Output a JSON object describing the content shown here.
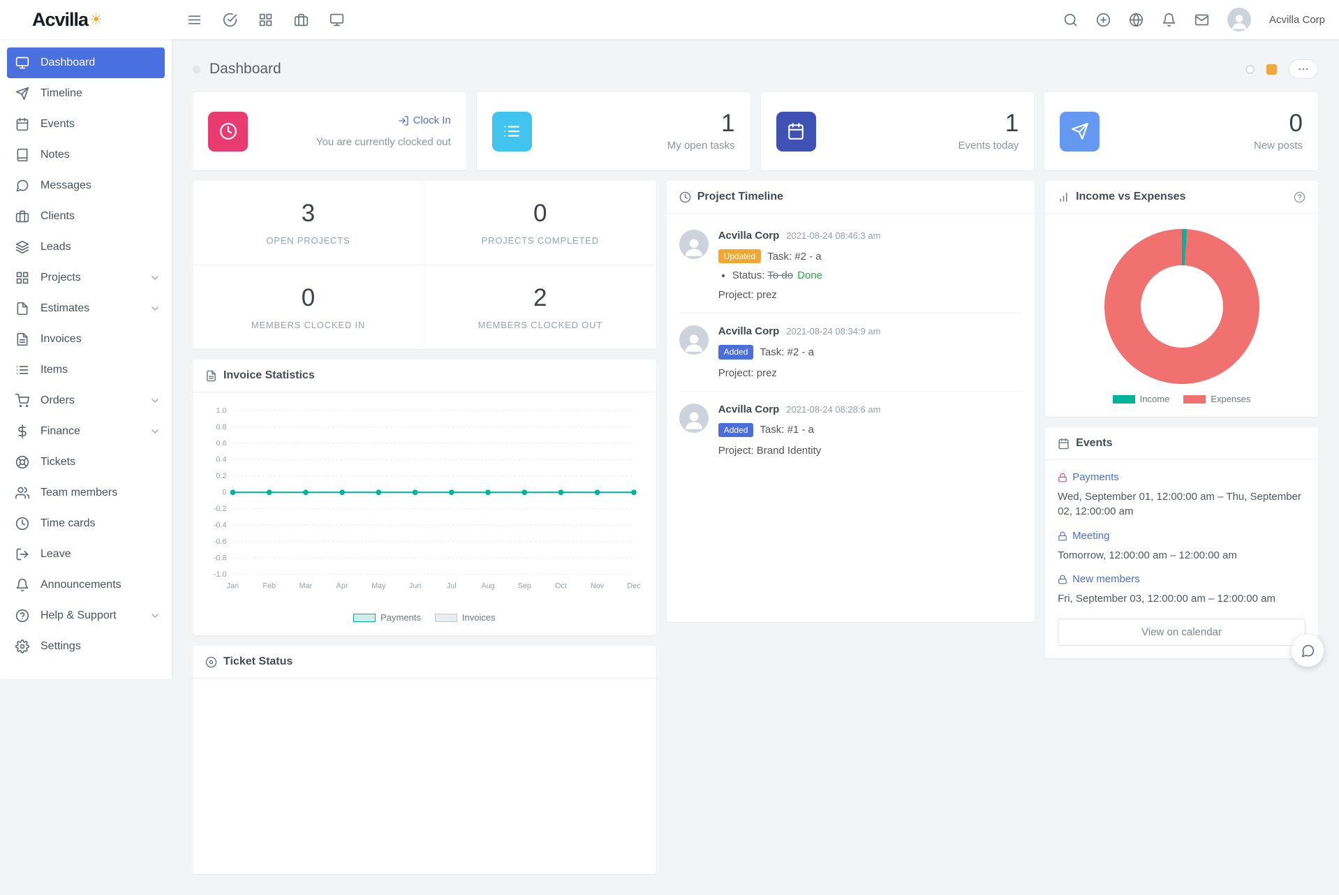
{
  "app": {
    "logo_text": "Acvilla",
    "workspace_name": "Acvilla Corp"
  },
  "page": {
    "title": "Dashboard"
  },
  "colors": {
    "accent": "#4a6fe0",
    "link": "#4a6fdd",
    "success": "#28a745"
  },
  "sidebar": {
    "items": [
      {
        "label": "Dashboard",
        "icon": "monitor",
        "active": true
      },
      {
        "label": "Timeline",
        "icon": "send"
      },
      {
        "label": "Events",
        "icon": "calendar"
      },
      {
        "label": "Notes",
        "icon": "book"
      },
      {
        "label": "Messages",
        "icon": "message-circle"
      },
      {
        "label": "Clients",
        "icon": "briefcase"
      },
      {
        "label": "Leads",
        "icon": "layers"
      },
      {
        "label": "Projects",
        "icon": "grid",
        "expandable": true
      },
      {
        "label": "Estimates",
        "icon": "file",
        "expandable": true
      },
      {
        "label": "Invoices",
        "icon": "file-text"
      },
      {
        "label": "Items",
        "icon": "list"
      },
      {
        "label": "Orders",
        "icon": "shopping-cart",
        "expandable": true
      },
      {
        "label": "Finance",
        "icon": "dollar-sign",
        "expandable": true
      },
      {
        "label": "Tickets",
        "icon": "life-buoy"
      },
      {
        "label": "Team members",
        "icon": "users"
      },
      {
        "label": "Time cards",
        "icon": "clock"
      },
      {
        "label": "Leave",
        "icon": "log-out"
      },
      {
        "label": "Announcements",
        "icon": "bell"
      },
      {
        "label": "Help & Support",
        "icon": "help-circle",
        "expandable": true
      },
      {
        "label": "Settings",
        "icon": "settings"
      }
    ]
  },
  "summary_cards": [
    {
      "icon": "clock",
      "tile_color": "#e93a71",
      "action_label": "Clock In",
      "subtitle": "You are currently clocked out"
    },
    {
      "icon": "list",
      "tile_color": "#41c5ee",
      "value": "1",
      "label": "My open tasks"
    },
    {
      "icon": "calendar",
      "tile_color": "#3f51b5",
      "value": "1",
      "label": "Events today"
    },
    {
      "icon": "send",
      "tile_color": "#6598f1",
      "value": "0",
      "label": "New posts"
    }
  ],
  "stats": [
    {
      "value": "3",
      "label": "OPEN PROJECTS"
    },
    {
      "value": "0",
      "label": "PROJECTS COMPLETED"
    },
    {
      "value": "0",
      "label": "MEMBERS CLOCKED IN"
    },
    {
      "value": "2",
      "label": "MEMBERS CLOCKED OUT"
    }
  ],
  "project_timeline": {
    "title": "Project Timeline",
    "entries": [
      {
        "author": "Acvilla Corp",
        "timestamp": "2021-08-24 08:46:3 am",
        "badge": "Updated",
        "badge_color": "#f3a72e",
        "task": "Task: #2 - a",
        "status_prefix": "Status:",
        "status_old": "To do",
        "status_new": "Done",
        "project": "Project: prez"
      },
      {
        "author": "Acvilla Corp",
        "timestamp": "2021-08-24 08:34:9 am",
        "badge": "Added",
        "badge_color": "#4a6fdd",
        "task": "Task: #2 - a",
        "project": "Project: prez"
      },
      {
        "author": "Acvilla Corp",
        "timestamp": "2021-08-24 08:28:6 am",
        "badge": "Added",
        "badge_color": "#4a6fdd",
        "task": "Task: #1 - a",
        "project": "Project: Brand Identity"
      }
    ]
  },
  "income_vs_expenses": {
    "title": "Income vs Expenses"
  },
  "invoice_statistics": {
    "title": "Invoice Statistics"
  },
  "ticket_status": {
    "title": "Ticket Status"
  },
  "events": {
    "title": "Events",
    "items": [
      {
        "title": "Payments",
        "icon_color": "#e83e8c",
        "time": "Wed, September 01, 12:00:00 am – Thu, September 02, 12:00:00 am"
      },
      {
        "title": "Meeting",
        "icon_color": "#4a6fdd",
        "time": "Tomorrow, 12:00:00 am – 12:00:00 am"
      },
      {
        "title": "New members",
        "icon_color": "#4a6fdd",
        "time": "Fri, September 03, 12:00:00 am – 12:00:00 am"
      }
    ],
    "button_label": "View on calendar"
  },
  "chart_data": [
    {
      "type": "line",
      "title": "Invoice Statistics",
      "categories": [
        "Jan",
        "Feb",
        "Mar",
        "Apr",
        "May",
        "Jun",
        "Jul",
        "Aug",
        "Sep",
        "Oct",
        "Nov",
        "Dec"
      ],
      "series": [
        {
          "name": "Payments",
          "values": [
            0,
            0,
            0,
            0,
            0,
            0,
            0,
            0,
            0,
            0,
            0,
            0
          ],
          "color": "#00b39b",
          "swatch": "#cdeee8"
        },
        {
          "name": "Invoices",
          "values": [
            0,
            0,
            0,
            0,
            0,
            0,
            0,
            0,
            0,
            0,
            0,
            0
          ],
          "color": "#c3cad1",
          "swatch": "#e9edf0"
        }
      ],
      "ylim": [
        -1.0,
        1.0
      ],
      "ytick_step": 0.2,
      "grid": true,
      "legend_position": "bottom"
    },
    {
      "type": "pie",
      "subtype": "donut",
      "title": "Income vs Expenses",
      "labels": [
        "Income",
        "Expenses"
      ],
      "values": [
        1,
        99
      ],
      "colors": [
        "#00b39b",
        "#f07170"
      ],
      "legend_position": "bottom"
    }
  ]
}
